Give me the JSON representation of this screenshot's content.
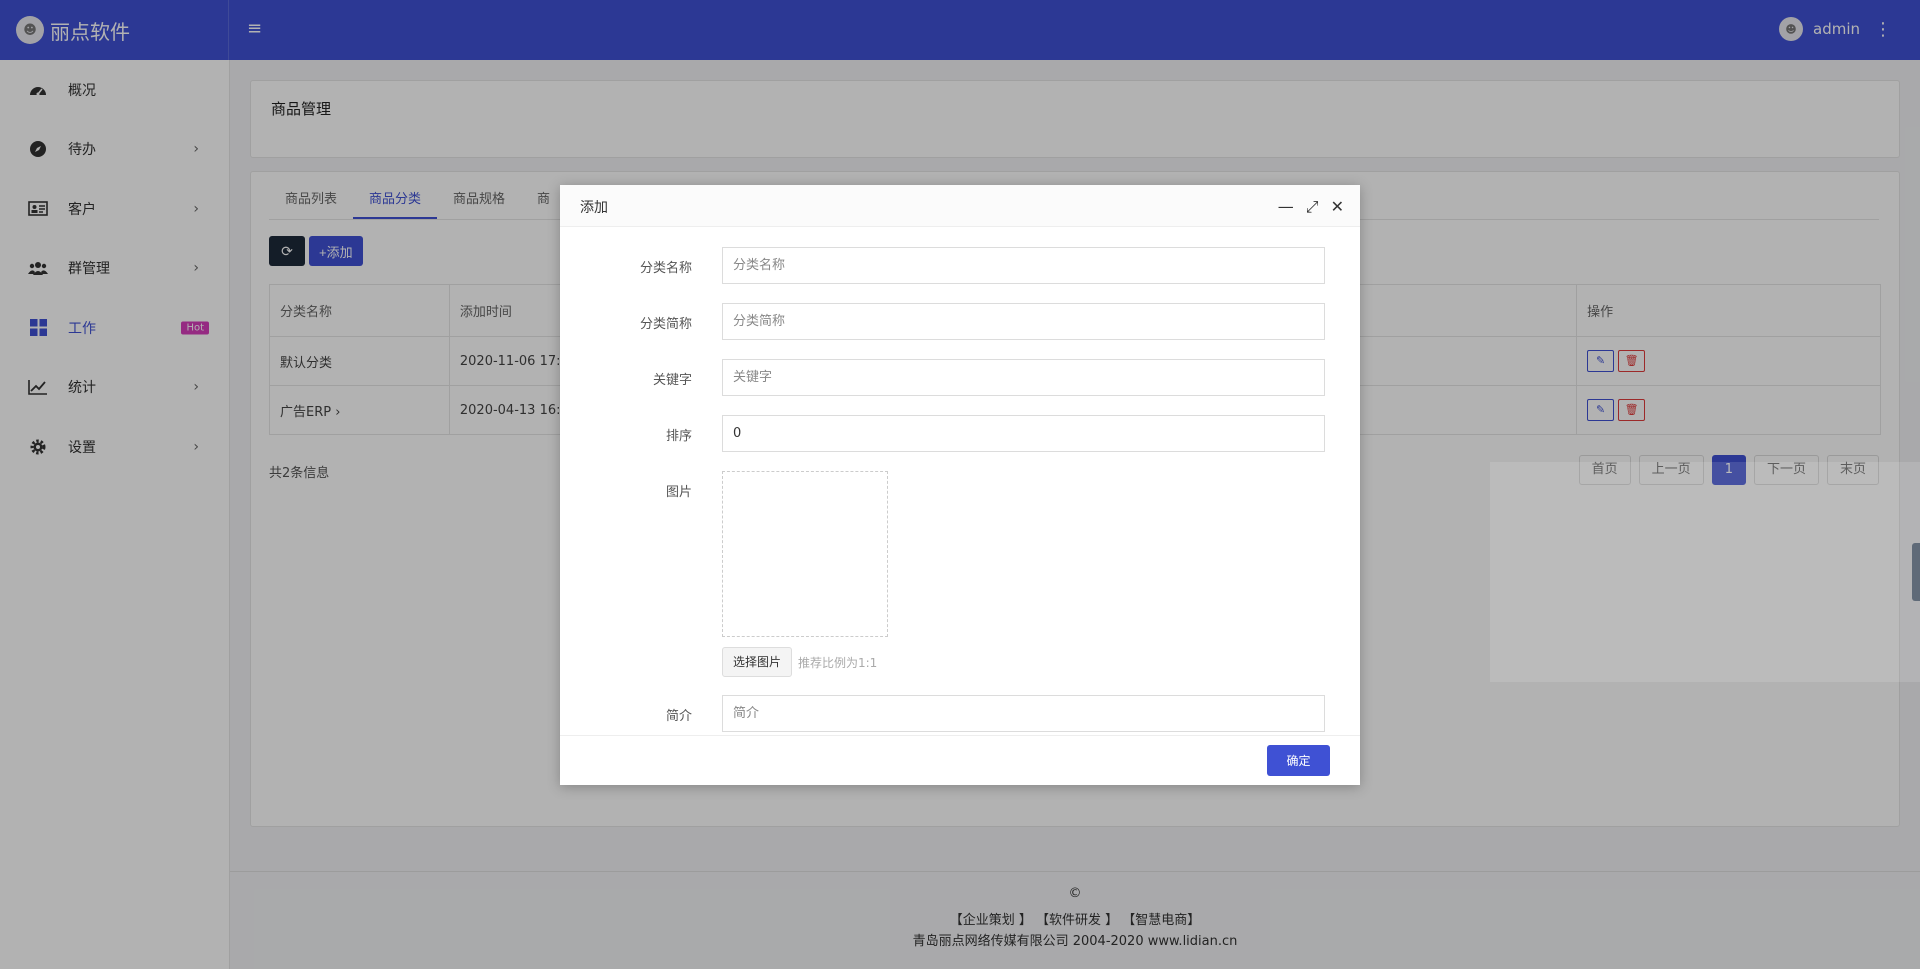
{
  "brand": {
    "name": "丽点软件"
  },
  "header": {
    "menu_icon": "≡",
    "user_name": "admin"
  },
  "sidebar": {
    "items": [
      {
        "label": "概况",
        "icon": "dashboard-icon",
        "has_chevron": false
      },
      {
        "label": "待办",
        "icon": "compass-icon",
        "has_chevron": true
      },
      {
        "label": "客户",
        "icon": "id-card-icon",
        "has_chevron": true
      },
      {
        "label": "群管理",
        "icon": "users-icon",
        "has_chevron": true
      },
      {
        "label": "工作",
        "icon": "grid-icon",
        "badge": "Hot",
        "active": true
      },
      {
        "label": "统计",
        "icon": "line-chart-icon",
        "has_chevron": true
      },
      {
        "label": "设置",
        "icon": "gear-icon",
        "has_chevron": true
      }
    ]
  },
  "page": {
    "title": "商品管理"
  },
  "tabs": [
    "商品列表",
    "商品分类",
    "商品规格",
    "商"
  ],
  "toolbar": {
    "add_label": "添加"
  },
  "table": {
    "headers": [
      "分类名称",
      "添加时间",
      "操作"
    ],
    "rows": [
      {
        "name": "默认分类",
        "time": "2020-11-06 17:2"
      },
      {
        "name": "广告ERP",
        "time": "2020-04-13 16:"
      }
    ]
  },
  "count_text": "共2条信息",
  "pager": {
    "first": "首页",
    "prev": "上一页",
    "current": "1",
    "next": "下一页",
    "last": "末页"
  },
  "footer": {
    "copyright": "©",
    "links": "【企业策划 】 【软件研发 】 【智慧电商】",
    "company": "青岛丽点网络传媒有限公司 2004-2020 www.lidian.cn"
  },
  "modal": {
    "title": "添加",
    "fields": {
      "name_label": "分类名称",
      "name_placeholder": "分类名称",
      "short_label": "分类简称",
      "short_placeholder": "分类简称",
      "keyword_label": "关键字",
      "keyword_placeholder": "关键字",
      "sort_label": "排序",
      "sort_value": "0",
      "image_label": "图片",
      "choose_image": "选择图片",
      "image_hint": "推荐比例为1:1",
      "intro_label": "简介",
      "intro_placeholder": "简介"
    },
    "confirm": "确定"
  },
  "colors": {
    "primary": "#3f51d4",
    "danger": "#e03b3b",
    "hot": "#d63dba",
    "dark_button": "#1e2a3a"
  }
}
